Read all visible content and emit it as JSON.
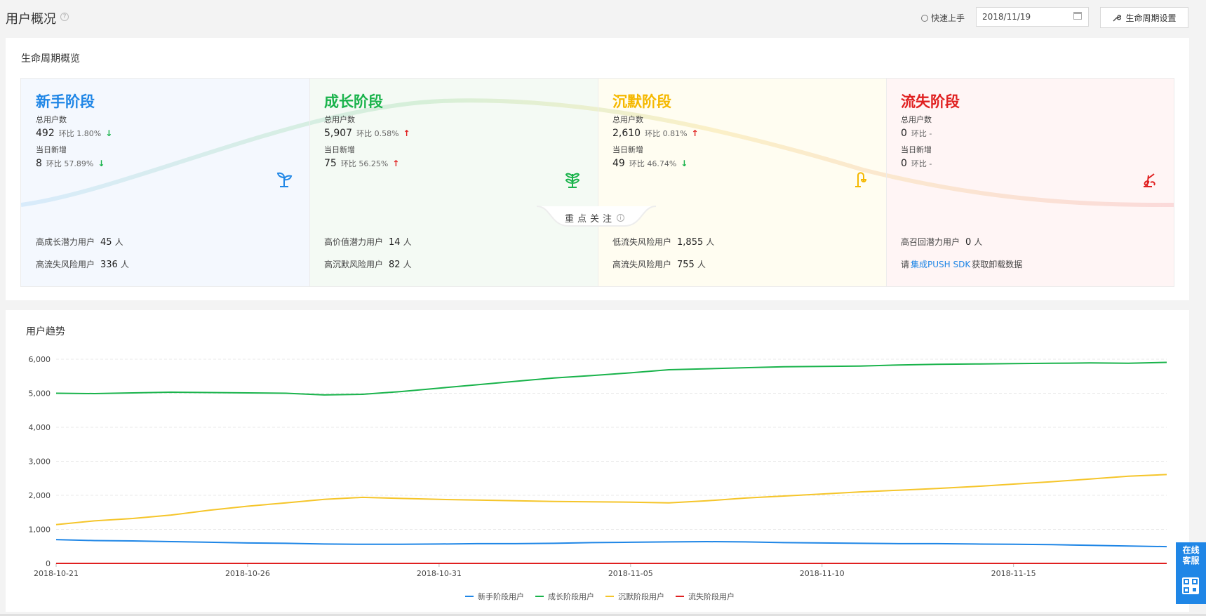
{
  "header": {
    "title": "用户概况",
    "quick_start": "快速上手",
    "date": "2018/11/19",
    "settings_label": "生命周期设置"
  },
  "overview": {
    "title": "生命周期概览",
    "total_label": "总用户数",
    "daily_label": "当日新增",
    "cmp_label": "环比",
    "focus_label": "重点关注",
    "stages": [
      {
        "name": "新手阶段",
        "color": "#1f86e6",
        "total": "492",
        "total_cmp": "1.80%",
        "total_dir": "down",
        "daily": "8",
        "daily_cmp": "57.89%",
        "daily_dir": "down",
        "icon": "sprout-icon"
      },
      {
        "name": "成长阶段",
        "color": "#19b34b",
        "total": "5,907",
        "total_cmp": "0.58%",
        "total_dir": "up",
        "daily": "75",
        "daily_cmp": "56.25%",
        "daily_dir": "up",
        "icon": "plant-icon"
      },
      {
        "name": "沉默阶段",
        "color": "#f5b800",
        "total": "2,610",
        "total_cmp": "0.81%",
        "total_dir": "up",
        "daily": "49",
        "daily_cmp": "46.74%",
        "daily_dir": "down",
        "icon": "wilting-plant-icon"
      },
      {
        "name": "流失阶段",
        "color": "#e02020",
        "total": "0",
        "total_cmp": "-",
        "total_dir": "none",
        "daily": "0",
        "daily_cmp": "-",
        "daily_dir": "none",
        "icon": "dead-plant-icon"
      }
    ],
    "focus": [
      [
        {
          "label": "高成长潜力用户",
          "value": "45",
          "unit": "人"
        },
        {
          "label": "高流失风险用户",
          "value": "336",
          "unit": "人"
        }
      ],
      [
        {
          "label": "高价值潜力用户",
          "value": "14",
          "unit": "人"
        },
        {
          "label": "高沉默风险用户",
          "value": "82",
          "unit": "人"
        }
      ],
      [
        {
          "label": "低流失风险用户",
          "value": "1,855",
          "unit": "人"
        },
        {
          "label": "高流失风险用户",
          "value": "755",
          "unit": "人"
        }
      ],
      [
        {
          "label": "高召回潜力用户",
          "value": "0",
          "unit": "人"
        }
      ]
    ],
    "sdk_note": {
      "prefix": "请",
      "link": "集成PUSH SDK",
      "suffix": "获取卸载数据"
    }
  },
  "chart_data": {
    "title": "用户趋势",
    "type": "line",
    "ylim": [
      0,
      6000
    ],
    "yticks": [
      "0",
      "1,000",
      "2,000",
      "3,000",
      "4,000",
      "5,000",
      "6,000"
    ],
    "ytick_values": [
      0,
      1000,
      2000,
      3000,
      4000,
      5000,
      6000
    ],
    "xticks": [
      "2018-10-21",
      "2018-10-26",
      "2018-10-31",
      "2018-11-05",
      "2018-11-10",
      "2018-11-15"
    ],
    "xtick_index": [
      0,
      5,
      10,
      15,
      20,
      25
    ],
    "x": [
      "2018-10-21",
      "2018-10-22",
      "2018-10-23",
      "2018-10-24",
      "2018-10-25",
      "2018-10-26",
      "2018-10-27",
      "2018-10-28",
      "2018-10-29",
      "2018-10-30",
      "2018-10-31",
      "2018-11-01",
      "2018-11-02",
      "2018-11-03",
      "2018-11-04",
      "2018-11-05",
      "2018-11-06",
      "2018-11-07",
      "2018-11-08",
      "2018-11-09",
      "2018-11-10",
      "2018-11-11",
      "2018-11-12",
      "2018-11-13",
      "2018-11-14",
      "2018-11-15",
      "2018-11-16",
      "2018-11-17",
      "2018-11-18",
      "2018-11-19"
    ],
    "grid": true,
    "legend": "bottom",
    "series": [
      {
        "name": "新手阶段用户",
        "color": "#1f86e6",
        "values": [
          700,
          670,
          660,
          640,
          620,
          600,
          590,
          570,
          560,
          560,
          570,
          580,
          580,
          590,
          610,
          620,
          630,
          640,
          630,
          610,
          600,
          590,
          580,
          580,
          570,
          560,
          550,
          530,
          510,
          492
        ]
      },
      {
        "name": "成长阶段用户",
        "color": "#19b34b",
        "values": [
          5000,
          4990,
          5010,
          5030,
          5020,
          5010,
          5000,
          4950,
          4970,
          5050,
          5150,
          5250,
          5350,
          5450,
          5520,
          5600,
          5690,
          5720,
          5750,
          5780,
          5790,
          5800,
          5830,
          5850,
          5860,
          5870,
          5880,
          5890,
          5880,
          5907
        ]
      },
      {
        "name": "沉默阶段用户",
        "color": "#f5c52a",
        "values": [
          1140,
          1250,
          1320,
          1420,
          1560,
          1680,
          1780,
          1880,
          1940,
          1910,
          1880,
          1860,
          1840,
          1820,
          1810,
          1800,
          1780,
          1840,
          1920,
          1980,
          2040,
          2100,
          2150,
          2200,
          2260,
          2330,
          2400,
          2480,
          2560,
          2610
        ]
      },
      {
        "name": "流失阶段用户",
        "color": "#e02020",
        "values": [
          0,
          0,
          0,
          0,
          0,
          0,
          0,
          0,
          0,
          0,
          0,
          0,
          0,
          0,
          0,
          0,
          0,
          0,
          0,
          0,
          0,
          0,
          0,
          0,
          0,
          0,
          0,
          0,
          0,
          0
        ]
      }
    ]
  },
  "service": {
    "label": "在线客服"
  }
}
